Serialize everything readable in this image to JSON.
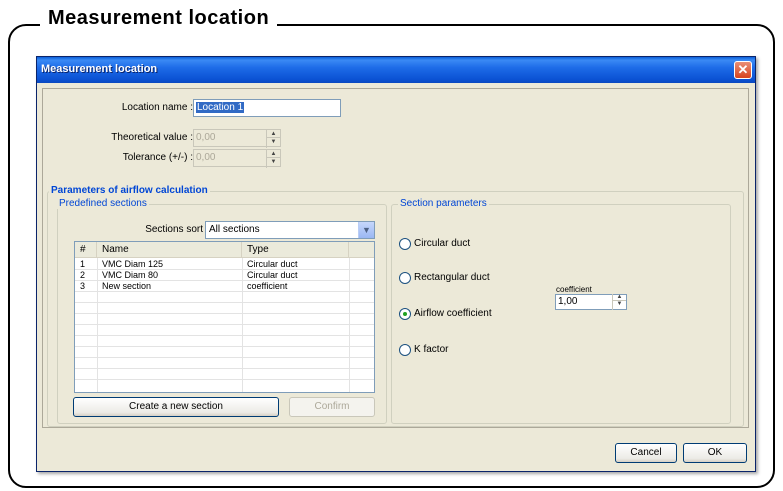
{
  "document": {
    "title": "Measurement location"
  },
  "window": {
    "title": "Measurement location",
    "close_glyph": "✕"
  },
  "form": {
    "location_name_label": "Location name :",
    "location_name_value": "Location 1",
    "theoretical_label": "Theoretical value :",
    "theoretical_value": "0,00",
    "tolerance_label": "Tolerance (+/-) :",
    "tolerance_value": "0,00"
  },
  "airflow": {
    "group_title": "Parameters of airflow calculation",
    "predefined": {
      "group_title": "Predefined sections",
      "sort_label": "Sections sort",
      "sort_value": "All sections",
      "columns": [
        "#",
        "Name",
        "Type"
      ],
      "rows": [
        [
          "1",
          "VMC Diam 125",
          "Circular duct"
        ],
        [
          "2",
          "VMC Diam 80",
          "Circular duct"
        ],
        [
          "3",
          "New section",
          "coefficient"
        ]
      ],
      "create_button": "Create a new section",
      "confirm_button": "Confirm"
    },
    "section_params": {
      "group_title": "Section parameters",
      "options": [
        "Circular duct",
        "Rectangular duct",
        "Airflow coefficient",
        "K factor"
      ],
      "selected_option": "Airflow coefficient",
      "coefficient_label": "coefficient",
      "coefficient_value": "1,00"
    }
  },
  "footer": {
    "cancel_button": "Cancel",
    "ok_button": "OK"
  }
}
